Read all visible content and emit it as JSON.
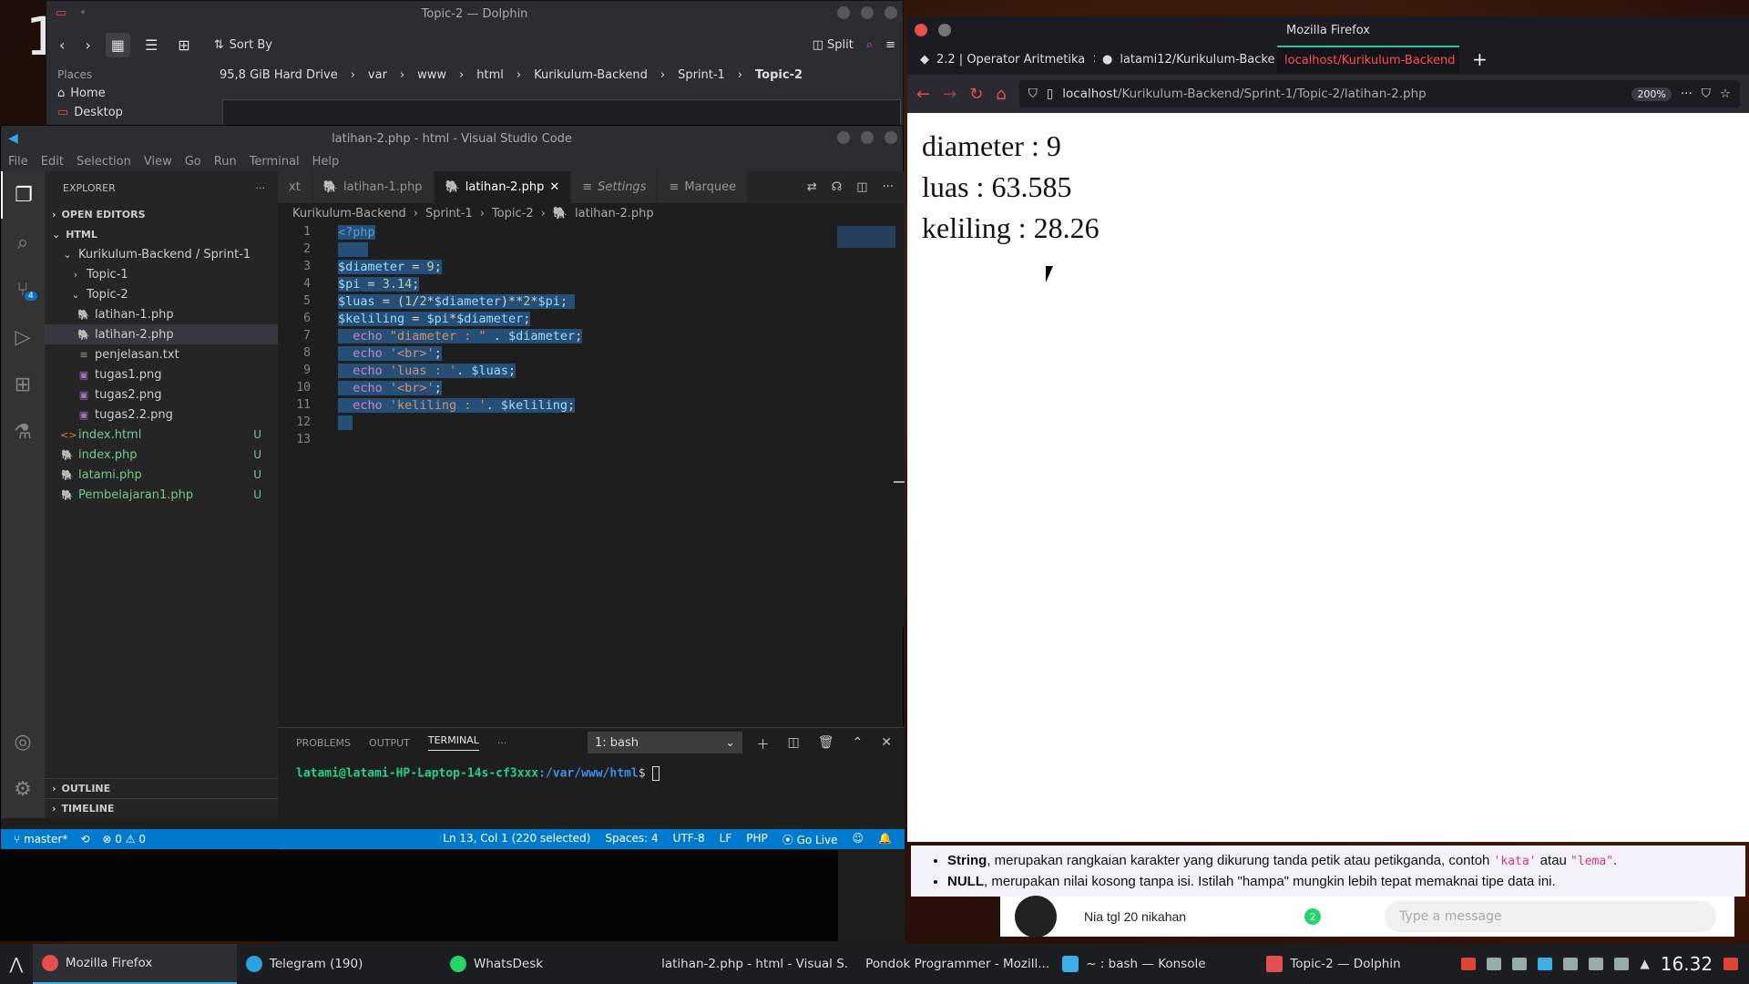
{
  "desktop": {
    "workspace_number": "1"
  },
  "dolphin": {
    "title": "Topic-2 — Dolphin",
    "sort_by": "Sort By",
    "split": "Split",
    "places_label": "Places",
    "places": [
      "Home",
      "Desktop"
    ],
    "breadcrumbs": [
      "95,8 GiB Hard Drive",
      "var",
      "www",
      "html",
      "Kurikulum-Backend",
      "Sprint-1"
    ],
    "current": "Topic-2"
  },
  "vscode": {
    "title": "latihan-2.php - html - Visual Studio Code",
    "menu": [
      "File",
      "Edit",
      "Selection",
      "View",
      "Go",
      "Run",
      "Terminal",
      "Help"
    ],
    "explorer_label": "EXPLORER",
    "open_editors": "OPEN EDITORS",
    "root": "HTML",
    "tree": [
      {
        "label": "Kurikulum-Backend / Sprint-1",
        "indent": 1,
        "type": "folder-open"
      },
      {
        "label": "Topic-1",
        "indent": 2,
        "type": "folder"
      },
      {
        "label": "Topic-2",
        "indent": 2,
        "type": "folder-open"
      },
      {
        "label": "latihan-1.php",
        "indent": 3,
        "type": "php"
      },
      {
        "label": "latihan-2.php",
        "indent": 3,
        "type": "php",
        "selected": true
      },
      {
        "label": "penjelasan.txt",
        "indent": 3,
        "type": "txt"
      },
      {
        "label": "tugas1.png",
        "indent": 3,
        "type": "png"
      },
      {
        "label": "tugas2.png",
        "indent": 3,
        "type": "png"
      },
      {
        "label": "tugas2.2.png",
        "indent": 3,
        "type": "png"
      },
      {
        "label": "index.html",
        "indent": 1,
        "type": "html",
        "badge": "U"
      },
      {
        "label": "index.php",
        "indent": 1,
        "type": "php",
        "badge": "U"
      },
      {
        "label": "latami.php",
        "indent": 1,
        "type": "php",
        "badge": "U"
      },
      {
        "label": "Pembelajaran1.php",
        "indent": 1,
        "type": "php",
        "badge": "U"
      }
    ],
    "outline": "OUTLINE",
    "timeline": "TIMELINE",
    "scm_badge": "4",
    "tabs": [
      {
        "label": "xt",
        "active": false
      },
      {
        "label": "latihan-1.php",
        "active": false
      },
      {
        "label": "latihan-2.php",
        "active": true
      },
      {
        "label": "Settings",
        "active": false,
        "italic": true
      },
      {
        "label": "Marquee",
        "active": false
      }
    ],
    "breadcrumb": [
      "Kurikulum-Backend",
      "Sprint-1",
      "Topic-2",
      "latihan-2.php"
    ],
    "code_lines": [
      "1",
      "2",
      "3",
      "4",
      "5",
      "6",
      "7",
      "8",
      "9",
      "10",
      "11",
      "12",
      "13"
    ],
    "panel_tabs": [
      "PROBLEMS",
      "OUTPUT",
      "TERMINAL"
    ],
    "terminal_select": "1: bash",
    "terminal_user": "latami@latami-HP-Laptop-14s-cf3xxx",
    "terminal_path": ":/var/www/html",
    "terminal_prompt": "$ ",
    "status": {
      "branch": "master*",
      "errors": "0",
      "warnings": "0",
      "position": "Ln 13, Col 1 (220 selected)",
      "spaces": "Spaces: 4",
      "encoding": "UTF-8",
      "eol": "LF",
      "lang": "PHP",
      "golive": "Go Live"
    }
  },
  "firefox": {
    "title": "Mozilla Firefox",
    "tabs": [
      {
        "label": "2.2 | Operator Aritmetika",
        "active": false
      },
      {
        "label": "latami12/Kurikulum-Backe",
        "active": false
      },
      {
        "label": "localhost/Kurikulum-Backend",
        "active": true
      }
    ],
    "url_host": "localhost",
    "url_path": "/Kurikulum-Backend/Sprint-1/Topic-2/latihan-2.php",
    "zoom": "200%",
    "output": [
      "diameter : 9",
      "luas : 63.585",
      "keliling : 28.26"
    ]
  },
  "lesson": {
    "string_bold": "String",
    "string_text": ", merupakan rangkaian karakter yang dikurung tanda petik atau petikganda, contoh ",
    "code1": "'kata'",
    "atau": " atau ",
    "code2": "\"lema\"",
    "dot": ".",
    "null_bold": "NULL",
    "null_text": ", merupakan nilai kosong tanpa isi. Istilah \"hampa\" mungkin lebih tepat memaknai tipe data ini."
  },
  "chat": {
    "text": "Nia tgl 20 nikahan",
    "badge": "2",
    "input_placeholder": "Type a message"
  },
  "taskbar": {
    "tasks": [
      "Mozilla Firefox",
      "Telegram (190)",
      "WhatsDesk",
      "latihan-2.php - html - Visual S...",
      "Pondok Programmer - Mozill...",
      "~ : bash — Konsole",
      "Topic-2 — Dolphin"
    ],
    "telegram_badge": "190",
    "clock": "16.32"
  }
}
